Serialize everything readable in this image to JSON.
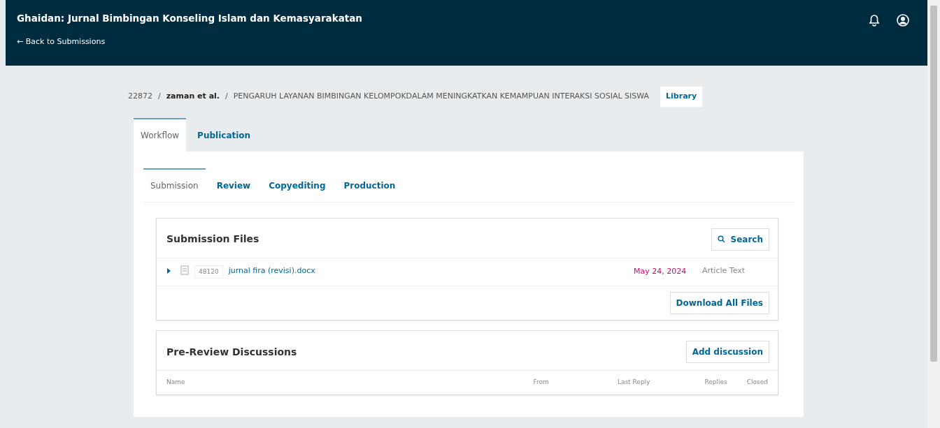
{
  "header": {
    "title": "Ghaidan: Jurnal Bimbingan Konseling Islam dan Kemasyarakatan",
    "back_link": "← Back to Submissions"
  },
  "breadcrumb": {
    "separator": "/",
    "id": "22872",
    "authors": "zaman et al.",
    "title": "PENGARUH LAYANAN BIMBINGAN KELOMPOKDALAM MENINGKATKAN KEMAMPUAN INTERAKSI SOSIAL SISWA",
    "library_button": "Library"
  },
  "tabs": [
    {
      "label": "Workflow",
      "selected": true
    },
    {
      "label": "Publication",
      "selected": false
    }
  ],
  "stage_tabs": [
    {
      "label": "Submission",
      "selected": true
    },
    {
      "label": "Review",
      "selected": false
    },
    {
      "label": "Copyediting",
      "selected": false
    },
    {
      "label": "Production",
      "selected": false
    }
  ],
  "submission_files": {
    "title": "Submission Files",
    "search_button": "Search",
    "files": [
      {
        "id": "48120",
        "name": "jurnal fira (revisi).docx",
        "date": "May 24, 2024",
        "type": "Article Text",
        "expanded": false
      }
    ],
    "download_button": "Download All Files"
  },
  "discussions": {
    "title": "Pre-Review Discussions",
    "add_button": "Add discussion",
    "columns": [
      "Name",
      "From",
      "Last Reply",
      "Replies",
      "Closed"
    ]
  }
}
